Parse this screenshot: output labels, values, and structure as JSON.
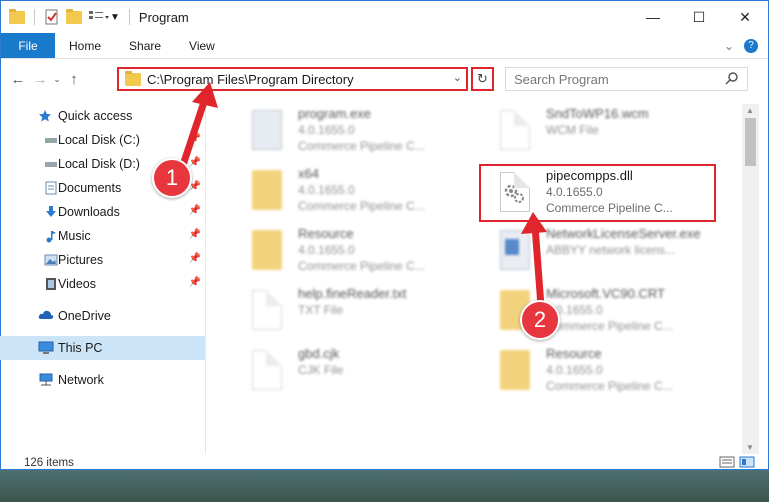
{
  "window": {
    "title": "Program"
  },
  "ribbon": {
    "tabs": [
      "File",
      "Home",
      "Share",
      "View"
    ]
  },
  "address": {
    "path": "C:\\Program Files\\Program Directory"
  },
  "search": {
    "placeholder": "Search Program"
  },
  "sidebar": {
    "items": [
      {
        "label": "Quick access",
        "icon": "star-icon"
      },
      {
        "label": "Local Disk (C:)",
        "icon": "drive-icon",
        "pinned": true
      },
      {
        "label": "Local Disk (D:)",
        "icon": "drive-icon",
        "pinned": true
      },
      {
        "label": "Documents",
        "icon": "documents-icon",
        "pinned": true
      },
      {
        "label": "Downloads",
        "icon": "download-icon",
        "pinned": true
      },
      {
        "label": "Music",
        "icon": "music-icon",
        "pinned": true
      },
      {
        "label": "Pictures",
        "icon": "pictures-icon",
        "pinned": true
      },
      {
        "label": "Videos",
        "icon": "videos-icon",
        "pinned": true
      },
      {
        "label": "OneDrive",
        "icon": "cloud-icon"
      },
      {
        "label": "This PC",
        "icon": "pc-icon",
        "selected": true
      },
      {
        "label": "Network",
        "icon": "network-icon"
      }
    ]
  },
  "files": [
    {
      "name": "program.exe",
      "line2": "4.0.1655.0",
      "line3": "Commerce Pipeline C...",
      "kind": "exe"
    },
    {
      "name": "SndToWP16.wcm",
      "line2": "WCM File",
      "line3": "",
      "kind": "doc"
    },
    {
      "name": "x64",
      "line2": "4.0.1655.0",
      "line3": "Commerce Pipeline C...",
      "kind": "folder"
    },
    {
      "name": "pipecompps.dll",
      "line2": "4.0.1655.0",
      "line3": "Commerce Pipeline C...",
      "kind": "dll"
    },
    {
      "name": "Resource",
      "line2": "4.0.1655.0",
      "line3": "Commerce Pipeline C...",
      "kind": "folder"
    },
    {
      "name": "NetworkLicenseServer.exe",
      "line2": "ABBYY network licens...",
      "line3": "",
      "kind": "exe2"
    },
    {
      "name": "help.fineReader.txt",
      "line2": "TXT File",
      "line3": "",
      "kind": "doc"
    },
    {
      "name": "Microsoft.VC90.CRT",
      "line2": "4.0.1655.0",
      "line3": "Commerce Pipeline C...",
      "kind": "folder"
    },
    {
      "name": "gbd.cjk",
      "line2": "CJK File",
      "line3": "",
      "kind": "doc"
    },
    {
      "name": "Resource",
      "line2": "4.0.1655.0",
      "line3": "Commerce Pipeline C...",
      "kind": "folder"
    }
  ],
  "status": {
    "count": "126 items"
  },
  "annotations": {
    "step1": "1",
    "step2": "2"
  },
  "colors": {
    "accent": "#1979ca",
    "highlight": "#e0262c"
  }
}
